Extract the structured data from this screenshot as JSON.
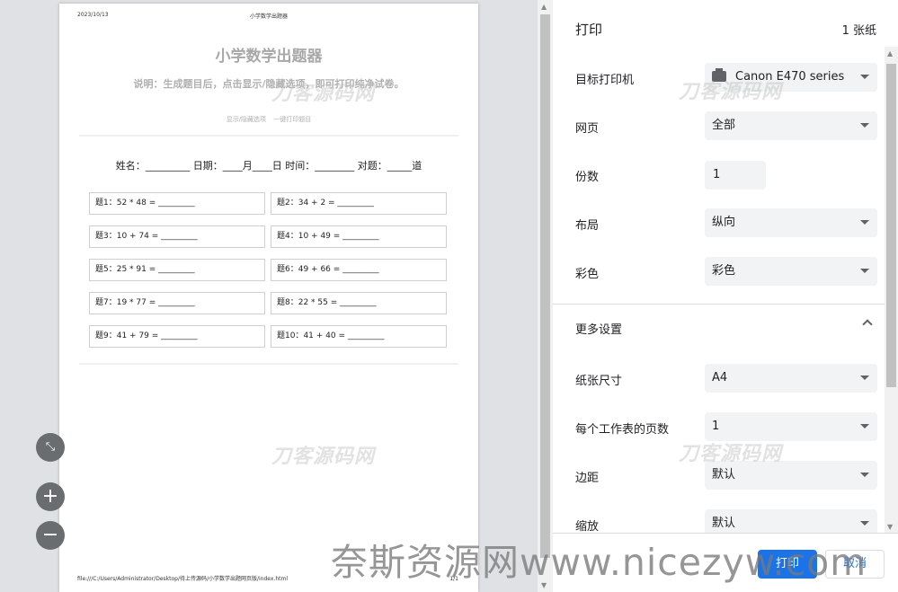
{
  "preview": {
    "header_date": "2023/10/13",
    "header_title": "小学数学出题器",
    "doc_title": "小学数学出题器",
    "doc_description": "说明：生成题目后，点击显示/隐藏选项，即可打印纯净试卷。",
    "link_toggle": "显示/隐藏选项",
    "link_print": "一键打印题目",
    "info_line": "姓名：_________ 日期：____月____日 时间：________ 对题：_____道",
    "questions": [
      "题1：52 * 48 = _________",
      "题2：34 + 2 = _________",
      "题3：10 + 74 = _________",
      "题4：10 + 49 = _________",
      "题5：25 * 91 = _________",
      "题6：49 + 66 = _________",
      "题7：19 * 77 = _________",
      "题8：22 * 55 = _________",
      "题9：41 + 79 = _________",
      "题10：41 + 40 = _________"
    ],
    "footer_path": "file:///C:/Users/Administrator/Desktop/待上传源码/小学数学出题网页版/index.html",
    "footer_page": "1/1",
    "watermark": "刀客源码网"
  },
  "zoom": {
    "fit_icon": "fit-to-page-icon",
    "plus": "+",
    "minus": "−"
  },
  "panel": {
    "title": "打印",
    "sheet_count": "1 张纸",
    "destination": {
      "label": "目标打印机",
      "value": "Canon E470 series",
      "icon": "printer-icon"
    },
    "pages": {
      "label": "网页",
      "value": "全部"
    },
    "copies": {
      "label": "份数",
      "value": "1"
    },
    "layout": {
      "label": "布局",
      "value": "纵向"
    },
    "color": {
      "label": "彩色",
      "value": "彩色"
    },
    "more_settings": {
      "label": "更多设置"
    },
    "paper_size": {
      "label": "纸张尺寸",
      "value": "A4"
    },
    "pages_per_sheet": {
      "label": "每个工作表的页数",
      "value": "1"
    },
    "margins": {
      "label": "边距",
      "value": "默认"
    },
    "scale": {
      "label": "缩放",
      "value": "默认"
    },
    "print_button": "打印",
    "cancel_button": "取消"
  },
  "site_watermark": "奈斯资源网www.nicezyw.com"
}
